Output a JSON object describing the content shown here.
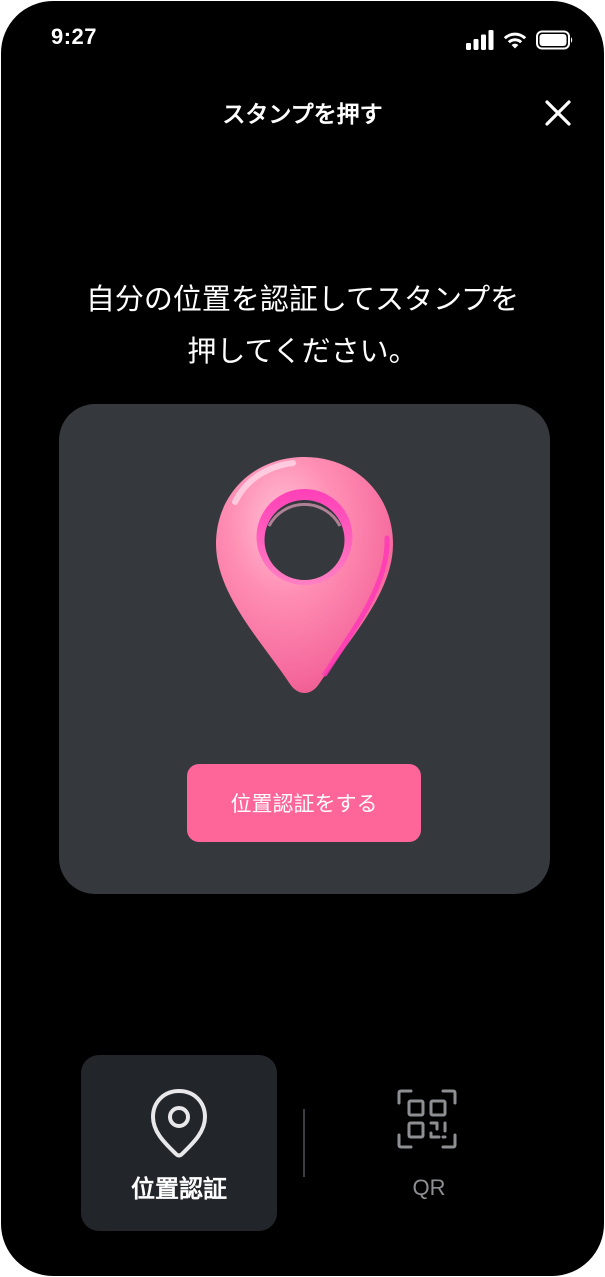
{
  "status_bar": {
    "time": "9:27",
    "icons": [
      "signal-icon",
      "wifi-icon",
      "battery-icon"
    ]
  },
  "header": {
    "title": "スタンプを押す",
    "close_icon": "close-icon"
  },
  "instruction": {
    "line1": "自分の位置を認証してスタンプを",
    "line2": "押してください。"
  },
  "card": {
    "illustration": "location-pin-icon",
    "button_label": "位置認証をする"
  },
  "tabs": [
    {
      "label": "位置認証",
      "icon": "location-pin-icon",
      "selected": true
    },
    {
      "label": "QR",
      "icon": "qr-scan-icon",
      "selected": false
    }
  ],
  "colors": {
    "background": "#000000",
    "card": "#35383c",
    "accent": "#fe6598",
    "tab_selected_bg": "#22252a",
    "tab_inactive_text": "#8d8f93"
  }
}
